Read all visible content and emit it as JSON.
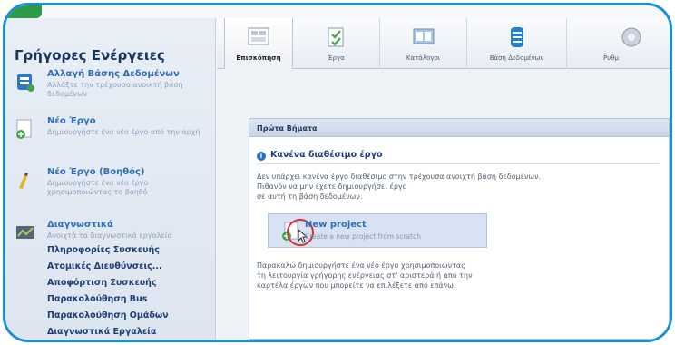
{
  "sidebar": {
    "title": "Γρήγορες Ενέργειες",
    "actions": [
      {
        "title": "Αλλαγή Βάσης Δεδομένων",
        "desc": "Αλλάξτε την τρέχουσα ανοικτή βάση δεδομένων",
        "icon": "database-change-icon"
      },
      {
        "title": "Νέο Έργο",
        "desc": "Δημιουργήστε ένα νέο έργο από την αρχή",
        "icon": "new-project-icon"
      },
      {
        "title": "Νέο Έργο (Βοηθός)",
        "desc": "Δημιουργήστε ένα νέο έργο χρησιμοποιώντας το βοηθό",
        "icon": "wizard-icon"
      },
      {
        "title": "Διαγνωστικά",
        "desc": "Ανοιχτά τα διαγνωστικά εργαλεία",
        "icon": "diagnostics-icon"
      }
    ],
    "links": [
      "Πληροφορίες Συσκευής",
      "Ατομικές Διευθύνσεις...",
      "Αποφόρτιση Συσκευής",
      "Παρακολούθηση Bus",
      "Παρακολούθηση Ομάδων",
      "Διαγνωστικά Εργαλεία"
    ]
  },
  "toolbar": {
    "tabs": [
      {
        "label": "Επισκόπηση",
        "icon": "overview-icon",
        "active": true
      },
      {
        "label": "Έργα",
        "icon": "projects-icon",
        "active": false
      },
      {
        "label": "Κατάλογοι",
        "icon": "catalogs-icon",
        "active": false
      },
      {
        "label": "Βάση Δεδομένων",
        "icon": "database-icon",
        "active": false
      },
      {
        "label": "Ρυθμ",
        "icon": "settings-icon",
        "active": false
      }
    ]
  },
  "panel": {
    "header": "Πρώτα Βήματα",
    "subtitle": "Κανένα διαθέσιμο έργο",
    "text1": [
      "Δεν υπάρχει κανένα έργο διαθέσιμο στην τρέχουσα ανοιχτή βάση δεδομένων.",
      "Πιθανόν να μην έχετε δημιουργήσει έργο",
      "σε αυτή τη βάση δεδομένων."
    ],
    "new_project_title": "New project",
    "new_project_desc": "Create a new project from scratch",
    "text2": [
      "Παρακαλώ δημιουργήστε ένα νέο έργο χρησιμοποιώντας",
      "τη λειτουργία γρήγορης ενέργειας στ' αριστερά ή από την",
      "καρτέλα έργων που μπορείτε να επιλέξετε από επάνω."
    ]
  },
  "colors": {
    "frame": "#1c8fd6",
    "accent": "#2c6fb8",
    "corner": "#2f9a45"
  }
}
